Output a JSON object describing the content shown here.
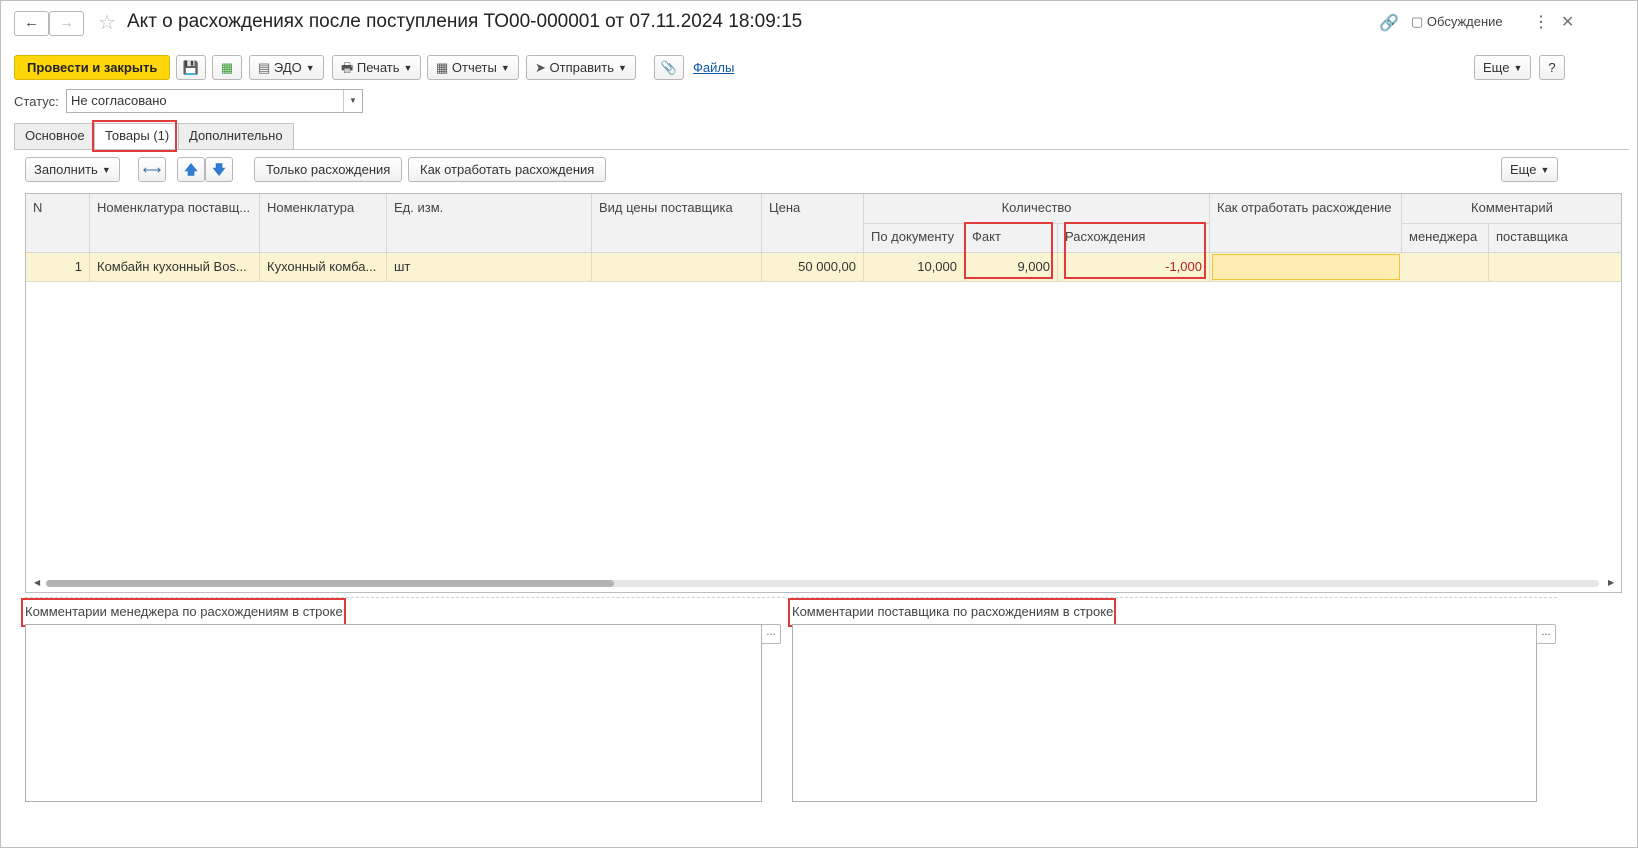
{
  "window": {
    "title": "Акт о расхождениях после поступления ТО00-000001 от 07.11.2024 18:09:15",
    "discussion_label": "Обсуждение"
  },
  "toolbar": {
    "post_close": "Провести и закрыть",
    "edo": "ЭДО",
    "print": "Печать",
    "reports": "Отчеты",
    "send": "Отправить",
    "files": "Файлы",
    "more": "Еще",
    "help": "?"
  },
  "status": {
    "label": "Статус:",
    "value": "Не согласовано"
  },
  "tabs": [
    {
      "label": "Основное"
    },
    {
      "label": "Товары (1)"
    },
    {
      "label": "Дополнительно"
    }
  ],
  "table_toolbar": {
    "fill": "Заполнить",
    "only_diff": "Только расхождения",
    "how_process": "Как отработать расхождения",
    "more": "Еще"
  },
  "table": {
    "headers": {
      "n": "N",
      "supplier_nom": "Номенклатура поставщ...",
      "nom": "Номенклатура",
      "unit": "Ед. изм.",
      "price_type": "Вид цены поставщика",
      "price": "Цена",
      "qty_group": "Количество",
      "qty_doc": "По документу",
      "qty_fact": "Факт",
      "qty_diff": "Расхождения",
      "how_process": "Как отработать расхождение",
      "comment_group": "Комментарий",
      "comment_manager": "менеджера",
      "comment_supplier": "поставщика"
    },
    "rows": [
      {
        "n": "1",
        "supplier_nom": "Комбайн кухонный Bos...",
        "nom": "Кухонный комба...",
        "unit": "шт",
        "price_type": "",
        "price": "50 000,00",
        "qty_doc": "10,000",
        "qty_fact": "9,000",
        "qty_diff": "-1,000",
        "how_process": "",
        "comment_manager": "",
        "comment_supplier": ""
      }
    ]
  },
  "comments": {
    "manager_label": "Комментарии менеджера по расхождениям в строке:",
    "supplier_label": "Комментарии поставщика по расхождениям в строке:",
    "ellipsis": "..."
  },
  "colors": {
    "primary_button": "#ffd60a",
    "highlight": "#e03a3a",
    "selected_row": "#fbf4d2",
    "link": "#0e57a8"
  }
}
